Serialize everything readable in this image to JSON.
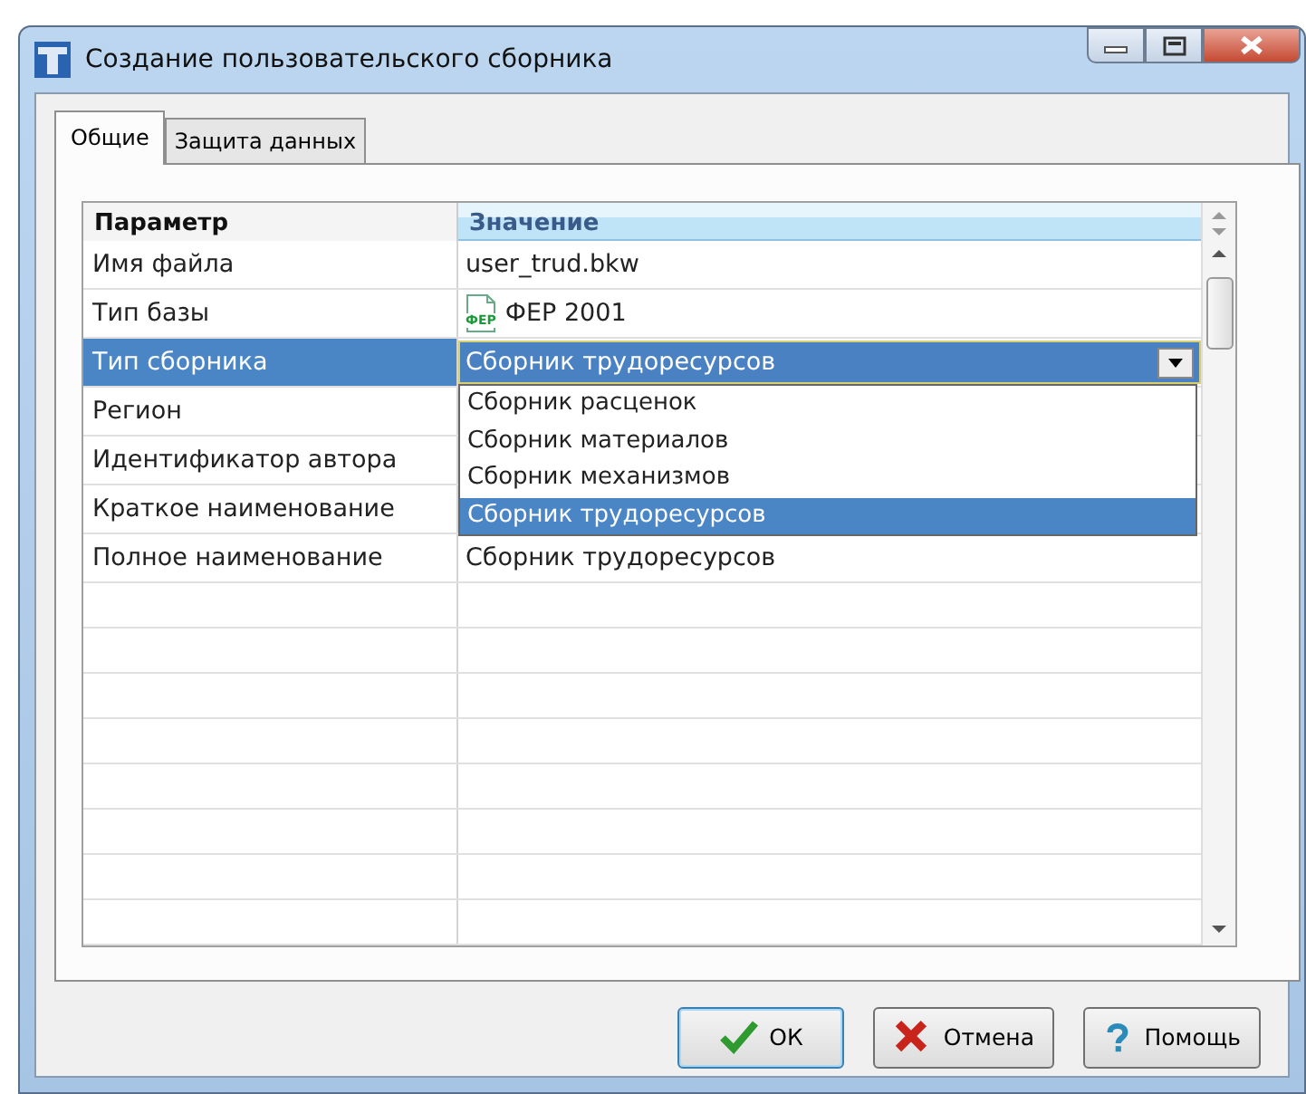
{
  "window": {
    "title": "Создание пользовательского сборника"
  },
  "tabs": [
    {
      "label": "Общие",
      "selected": true
    },
    {
      "label": "Защита данных",
      "selected": false
    }
  ],
  "grid": {
    "columns": [
      "Параметр",
      "Значение"
    ],
    "rows": [
      {
        "kind": "text",
        "param": "Имя файла",
        "value": "user_trud.bkw",
        "selected": false
      },
      {
        "kind": "icon",
        "param": "Тип базы",
        "value": "ФЕР 2001",
        "icon_text": "ФЕР",
        "selected": false
      },
      {
        "kind": "combo",
        "param": "Тип сборника",
        "value": "Сборник трудоресурсов",
        "selected": true,
        "expanded": true,
        "options": [
          {
            "label": "Сборник расценок",
            "selected": false
          },
          {
            "label": "Сборник материалов",
            "selected": false
          },
          {
            "label": "Сборник механизмов",
            "selected": false
          },
          {
            "label": "Сборник трудоресурсов",
            "selected": true
          }
        ]
      },
      {
        "kind": "text",
        "param": "Регион",
        "selected": false
      },
      {
        "kind": "text",
        "param": "Идентификатор автора",
        "selected": false
      },
      {
        "kind": "text",
        "param": "Краткое наименование",
        "selected": false
      },
      {
        "kind": "text",
        "param": "Полное наименование",
        "value": "Сборник трудоресурсов",
        "selected": false
      }
    ]
  },
  "buttons": [
    {
      "kind": "ok",
      "label": "ОК"
    },
    {
      "kind": "cancel",
      "label": "Отмена"
    },
    {
      "kind": "help",
      "label": "Помощь"
    }
  ]
}
